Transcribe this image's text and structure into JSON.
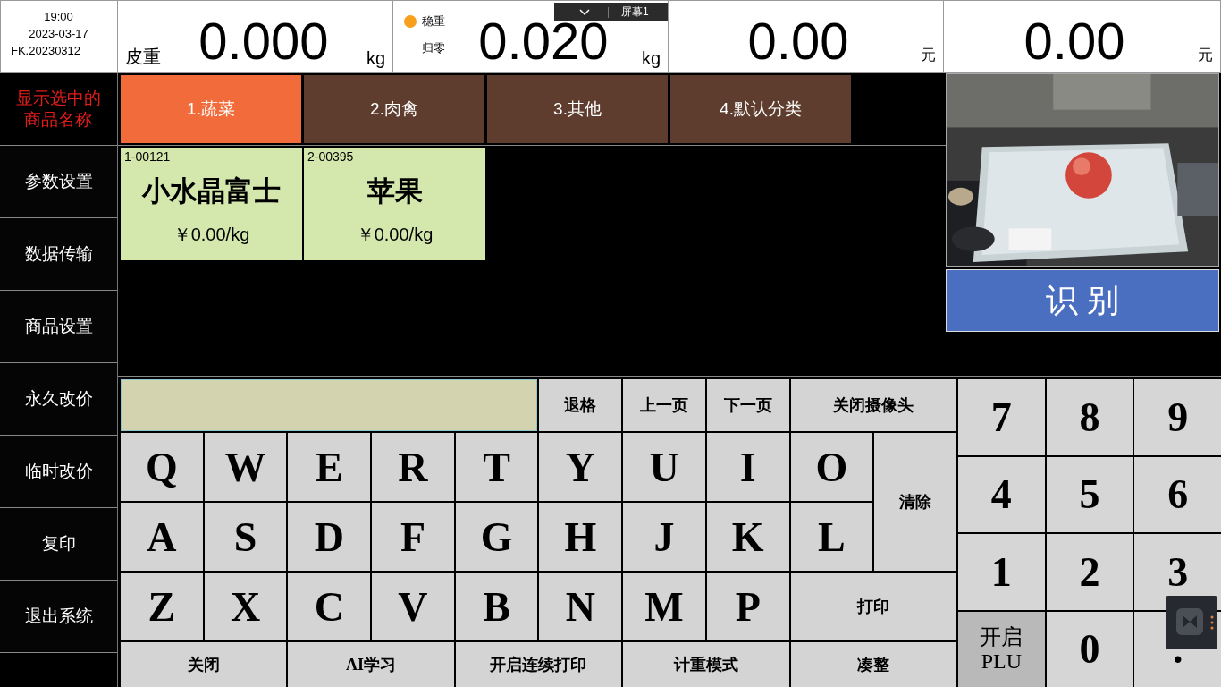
{
  "status": {
    "time": "19:00",
    "date": "2023-03-17",
    "version": "FK.20230312"
  },
  "displays": [
    {
      "label": "皮重",
      "value": "0.000",
      "unit": "kg"
    },
    {
      "indicators": [
        {
          "label": "稳重",
          "on": true
        },
        {
          "label": "归零",
          "on": false
        }
      ],
      "value": "0.020",
      "unit": "kg"
    },
    {
      "value": "0.00",
      "unit": "元"
    },
    {
      "value": "0.00",
      "unit": "元"
    }
  ],
  "screen_toolbar": {
    "label": "屏幕1"
  },
  "selected_name": "显示选中的商品名称",
  "sidebar": {
    "items": [
      "参数设置",
      "数据传输",
      "商品设置",
      "永久改价",
      "临时改价",
      "复印",
      "退出系统"
    ]
  },
  "categories": [
    {
      "label": "1.蔬菜",
      "selected": true
    },
    {
      "label": "2.肉禽",
      "selected": false
    },
    {
      "label": "3.其他",
      "selected": false
    },
    {
      "label": "4.默认分类",
      "selected": false
    }
  ],
  "products": [
    {
      "code": "1-00121",
      "name": "小水晶富士",
      "price": "￥0.00/kg"
    },
    {
      "code": "2-00395",
      "name": "苹果",
      "price": "￥0.00/kg"
    }
  ],
  "recognize_button": "识 别",
  "keyboard": {
    "keys": [
      {
        "label": "退格",
        "kind": "function"
      },
      {
        "label": "上一页",
        "kind": "function"
      },
      {
        "label": "下一页",
        "kind": "function"
      },
      {
        "label": "关闭摄像头",
        "kind": "function"
      },
      {
        "label": "Q",
        "kind": "letter"
      },
      {
        "label": "W",
        "kind": "letter"
      },
      {
        "label": "E",
        "kind": "letter"
      },
      {
        "label": "R",
        "kind": "letter"
      },
      {
        "label": "T",
        "kind": "letter"
      },
      {
        "label": "Y",
        "kind": "letter"
      },
      {
        "label": "U",
        "kind": "letter"
      },
      {
        "label": "I",
        "kind": "letter"
      },
      {
        "label": "O",
        "kind": "letter"
      },
      {
        "label": "清除",
        "kind": "function"
      },
      {
        "label": "A",
        "kind": "letter"
      },
      {
        "label": "S",
        "kind": "letter"
      },
      {
        "label": "D",
        "kind": "letter"
      },
      {
        "label": "F",
        "kind": "letter"
      },
      {
        "label": "G",
        "kind": "letter"
      },
      {
        "label": "H",
        "kind": "letter"
      },
      {
        "label": "J",
        "kind": "letter"
      },
      {
        "label": "K",
        "kind": "letter"
      },
      {
        "label": "L",
        "kind": "letter"
      },
      {
        "label": "Z",
        "kind": "letter"
      },
      {
        "label": "X",
        "kind": "letter"
      },
      {
        "label": "C",
        "kind": "letter"
      },
      {
        "label": "V",
        "kind": "letter"
      },
      {
        "label": "B",
        "kind": "letter"
      },
      {
        "label": "N",
        "kind": "letter"
      },
      {
        "label": "M",
        "kind": "letter"
      },
      {
        "label": "P",
        "kind": "letter"
      },
      {
        "label": "打印",
        "kind": "function"
      },
      {
        "label": "关闭",
        "kind": "function"
      },
      {
        "label": "AI学习",
        "kind": "function"
      },
      {
        "label": "开启连续打印",
        "kind": "function"
      },
      {
        "label": "计重模式",
        "kind": "function"
      },
      {
        "label": "凑整",
        "kind": "function"
      }
    ]
  },
  "numpad": [
    {
      "label": "7",
      "kind": "digit"
    },
    {
      "label": "8",
      "kind": "digit"
    },
    {
      "label": "9",
      "kind": "digit"
    },
    {
      "label": "4",
      "kind": "digit"
    },
    {
      "label": "5",
      "kind": "digit"
    },
    {
      "label": "6",
      "kind": "digit"
    },
    {
      "label": "1",
      "kind": "digit"
    },
    {
      "label": "2",
      "kind": "digit"
    },
    {
      "label": "3",
      "kind": "digit"
    },
    {
      "lines": [
        "开启",
        "PLU"
      ],
      "kind": "toggle"
    },
    {
      "label": "0",
      "kind": "digit"
    },
    {
      "label": ".",
      "kind": "digit"
    }
  ]
}
